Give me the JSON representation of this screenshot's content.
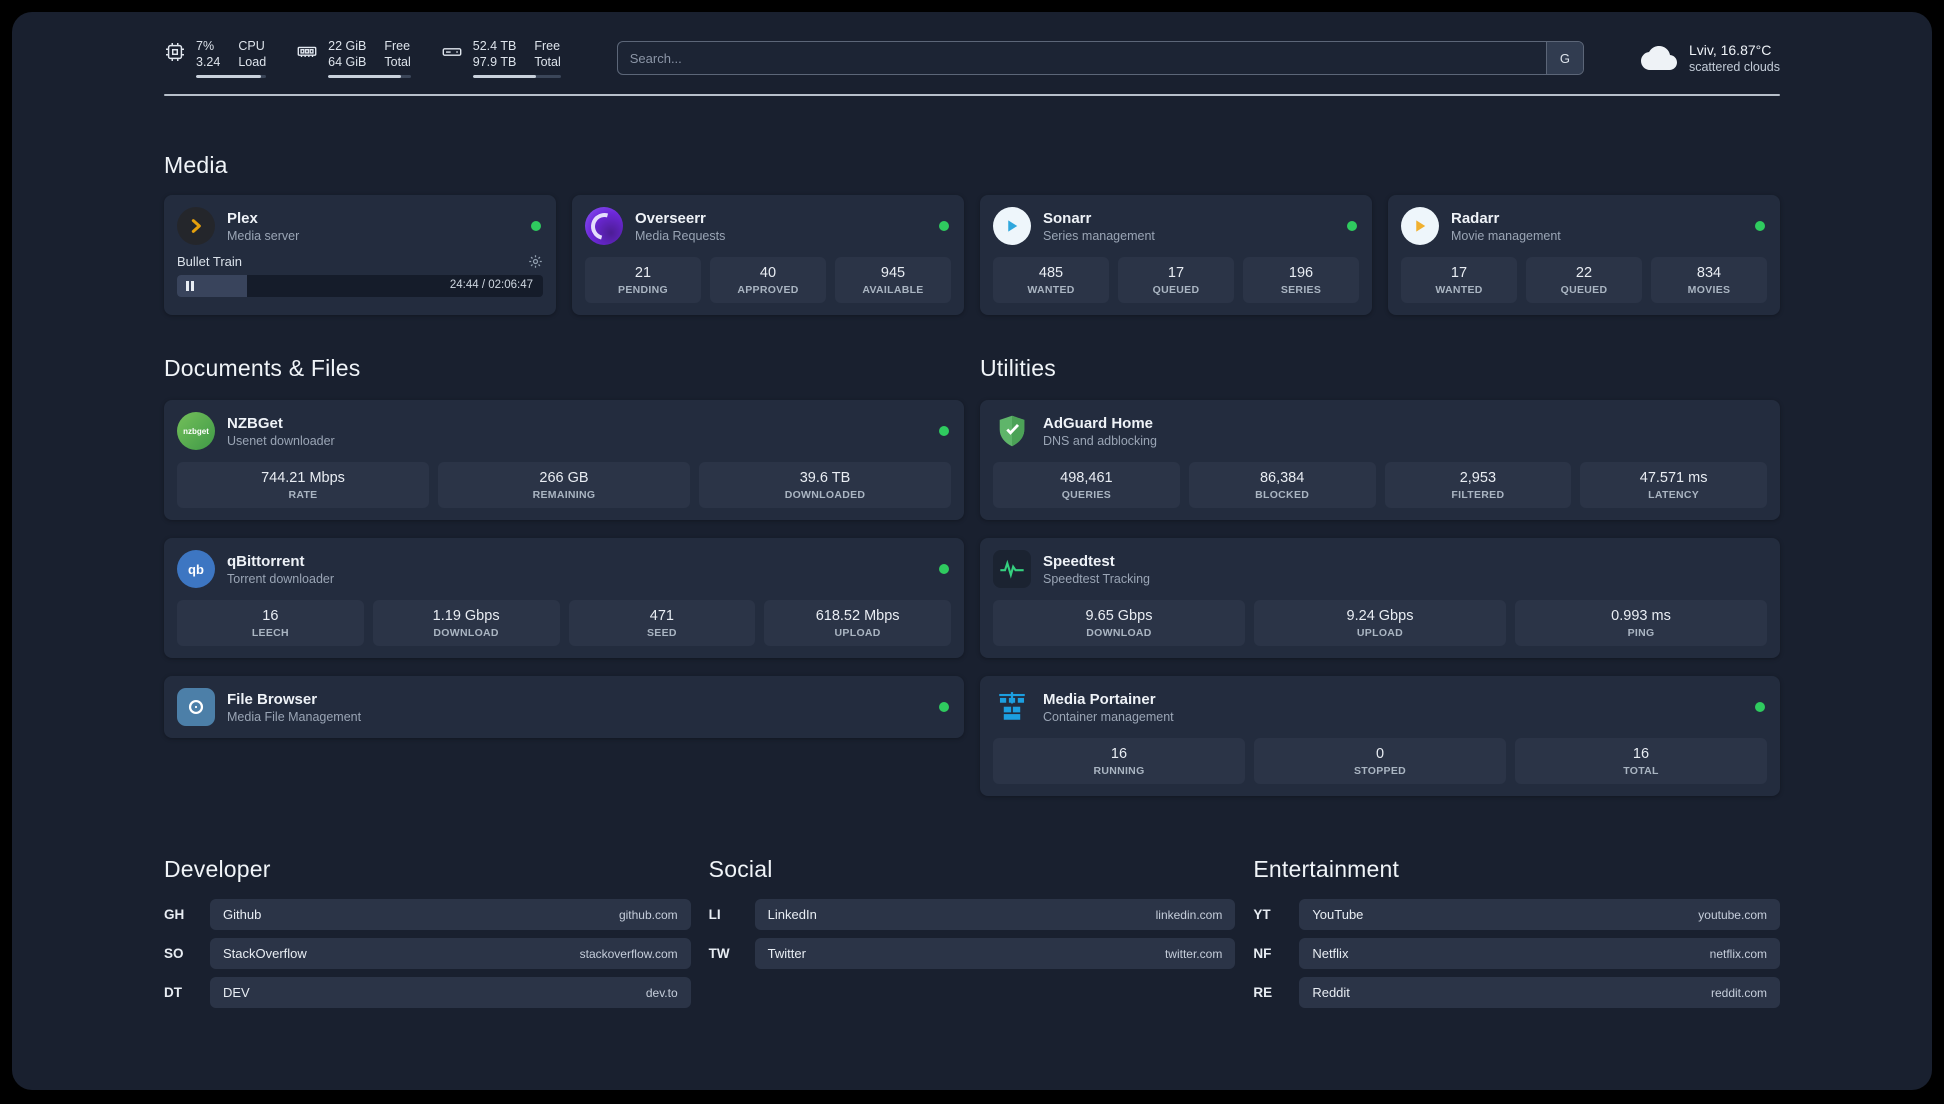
{
  "topbar": {
    "cpu": {
      "value_top": "7%",
      "value_bottom": "3.24",
      "label_top": "CPU",
      "label_bottom": "Load",
      "bar_pct": 93
    },
    "ram": {
      "value_top": "22 GiB",
      "value_bottom": "64 GiB",
      "label_top": "Free",
      "label_bottom": "Total",
      "bar_pct": 88
    },
    "disk": {
      "value_top": "52.4 TB",
      "value_bottom": "97.9 TB",
      "label_top": "Free",
      "label_bottom": "Total",
      "bar_pct": 72
    },
    "search": {
      "placeholder": "Search...",
      "shortcut": "G"
    },
    "weather": {
      "location": "Lviv, 16.87°C",
      "condition": "scattered clouds"
    }
  },
  "groups": {
    "media": {
      "title": "Media",
      "cards": [
        {
          "name": "Plex",
          "subtitle": "Media server",
          "player": {
            "track": "Bullet Train",
            "time": "24:44 / 02:06:47",
            "progress_pct": 19
          }
        },
        {
          "name": "Overseerr",
          "subtitle": "Media Requests",
          "stats": [
            {
              "value": "21",
              "label": "PENDING"
            },
            {
              "value": "40",
              "label": "APPROVED"
            },
            {
              "value": "945",
              "label": "AVAILABLE"
            }
          ]
        },
        {
          "name": "Sonarr",
          "subtitle": "Series management",
          "stats": [
            {
              "value": "485",
              "label": "WANTED"
            },
            {
              "value": "17",
              "label": "QUEUED"
            },
            {
              "value": "196",
              "label": "SERIES"
            }
          ]
        },
        {
          "name": "Radarr",
          "subtitle": "Movie management",
          "stats": [
            {
              "value": "17",
              "label": "WANTED"
            },
            {
              "value": "22",
              "label": "QUEUED"
            },
            {
              "value": "834",
              "label": "MOVIES"
            }
          ]
        }
      ]
    },
    "documents": {
      "title": "Documents & Files",
      "cards": [
        {
          "name": "NZBGet",
          "subtitle": "Usenet downloader",
          "icon_text": "nzbget",
          "stats": [
            {
              "value": "744.21 Mbps",
              "label": "RATE"
            },
            {
              "value": "266 GB",
              "label": "REMAINING"
            },
            {
              "value": "39.6 TB",
              "label": "DOWNLOADED"
            }
          ]
        },
        {
          "name": "qBittorrent",
          "subtitle": "Torrent downloader",
          "icon_text": "qb",
          "stats": [
            {
              "value": "16",
              "label": "LEECH"
            },
            {
              "value": "1.19 Gbps",
              "label": "DOWNLOAD"
            },
            {
              "value": "471",
              "label": "SEED"
            },
            {
              "value": "618.52 Mbps",
              "label": "UPLOAD"
            }
          ]
        },
        {
          "name": "File Browser",
          "subtitle": "Media File Management"
        }
      ]
    },
    "utilities": {
      "title": "Utilities",
      "cards": [
        {
          "name": "AdGuard Home",
          "subtitle": "DNS and adblocking",
          "stats": [
            {
              "value": "498,461",
              "label": "QUERIES"
            },
            {
              "value": "86,384",
              "label": "BLOCKED"
            },
            {
              "value": "2,953",
              "label": "FILTERED"
            },
            {
              "value": "47.571 ms",
              "label": "LATENCY"
            }
          ]
        },
        {
          "name": "Speedtest",
          "subtitle": "Speedtest Tracking",
          "stats": [
            {
              "value": "9.65 Gbps",
              "label": "DOWNLOAD"
            },
            {
              "value": "9.24 Gbps",
              "label": "UPLOAD"
            },
            {
              "value": "0.993 ms",
              "label": "PING"
            }
          ]
        },
        {
          "name": "Media Portainer",
          "subtitle": "Container management",
          "stats": [
            {
              "value": "16",
              "label": "RUNNING"
            },
            {
              "value": "0",
              "label": "STOPPED"
            },
            {
              "value": "16",
              "label": "TOTAL"
            }
          ]
        }
      ]
    }
  },
  "bookmarks": [
    {
      "title": "Developer",
      "items": [
        {
          "abbr": "GH",
          "name": "Github",
          "url": "github.com"
        },
        {
          "abbr": "SO",
          "name": "StackOverflow",
          "url": "stackoverflow.com"
        },
        {
          "abbr": "DT",
          "name": "DEV",
          "url": "dev.to"
        }
      ]
    },
    {
      "title": "Social",
      "items": [
        {
          "abbr": "LI",
          "name": "LinkedIn",
          "url": "linkedin.com"
        },
        {
          "abbr": "TW",
          "name": "Twitter",
          "url": "twitter.com"
        }
      ]
    },
    {
      "title": "Entertainment",
      "items": [
        {
          "abbr": "YT",
          "name": "YouTube",
          "url": "youtube.com"
        },
        {
          "abbr": "NF",
          "name": "Netflix",
          "url": "netflix.com"
        },
        {
          "abbr": "RE",
          "name": "Reddit",
          "url": "reddit.com"
        }
      ]
    }
  ]
}
